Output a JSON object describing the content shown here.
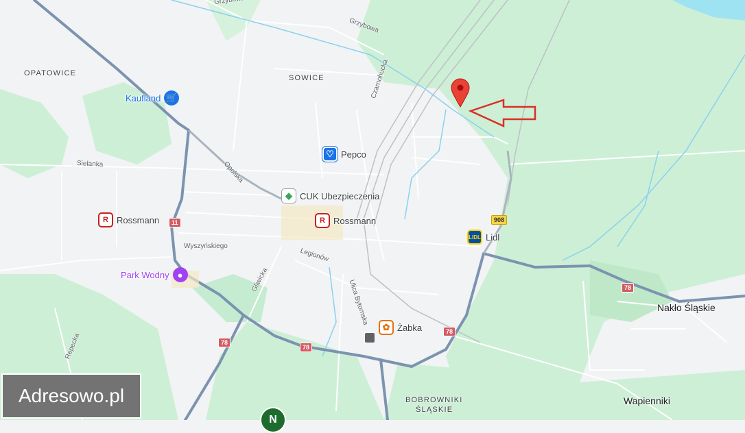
{
  "map": {
    "areas": {
      "opatowice": "OPATOWICE",
      "sowice": "SOWICE",
      "bobrowniki_line1": "BOBROWNIKI",
      "bobrowniki_line2": "ŚLĄSKIE"
    },
    "towns": {
      "naklo": "Nakło Śląskie",
      "wapienniki": "Wapienniki"
    },
    "streets": {
      "grzybowa": "Grzybowa",
      "czarnohucka": "Czarnohucka",
      "sielanka": "Sielanka",
      "opolska": "Opolska",
      "wyszynskiego": "Wyszyńskiego",
      "legionow": "Legionów",
      "gliwicka": "Gliwicka",
      "bytomska": "Ulica Bytomska",
      "repecka": "Repecka",
      "top_street": "Grzybowa"
    },
    "road_shields": {
      "r11": "11",
      "r908": "908",
      "r78_a": "78",
      "r78_b": "78",
      "r78_c": "78",
      "r78_d": "78"
    },
    "pois": {
      "kaufland": {
        "label": "Kaufland",
        "icon": "shopping-cart-icon",
        "color": "#1a73e8"
      },
      "pepco": {
        "label": "Pepco",
        "icon": "heart-shield-icon",
        "color": "#1a73e8"
      },
      "cuk": {
        "label": "CUK Ubezpieczenia",
        "icon": "diamond-icon",
        "color": "#34a853"
      },
      "rossmann_center": {
        "label": "Rossmann",
        "icon": "rossmann-icon",
        "color": "#c5221f"
      },
      "rossmann_west": {
        "label": "Rossmann",
        "icon": "rossmann-icon",
        "color": "#c5221f"
      },
      "lidl": {
        "label": "Lidl",
        "icon": "lidl-logo-icon",
        "color": "#0050aa"
      },
      "park_wodny": {
        "label": "Park Wodny",
        "icon": "park-icon",
        "color": "#a142f4"
      },
      "zabka": {
        "label": "Żabka",
        "icon": "zabka-icon",
        "color": "#e8710a"
      }
    },
    "marker": {
      "icon": "location-pin-icon",
      "color": "#ea4335"
    },
    "arrow": {
      "color": "#d93025"
    },
    "watermark": "Adresowo.pl",
    "badge": "N"
  }
}
